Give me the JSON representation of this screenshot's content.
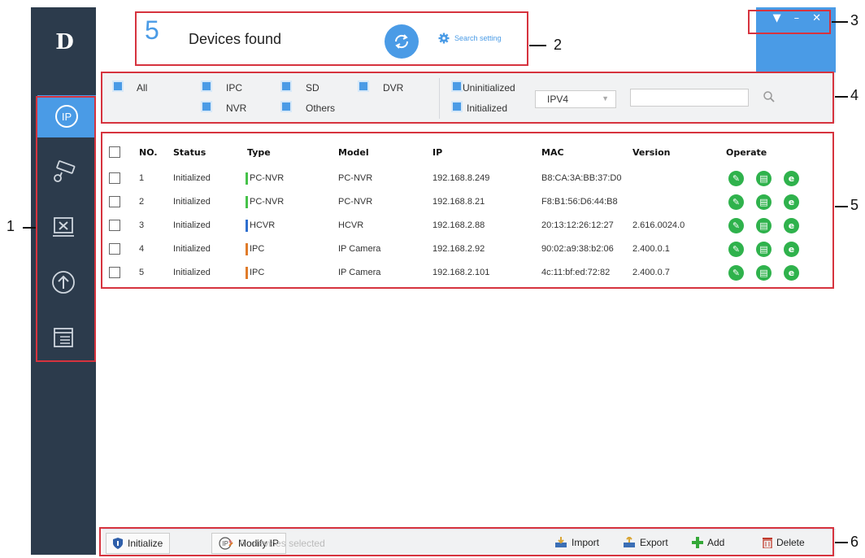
{
  "sidebar": {
    "logo": "D",
    "items": [
      {
        "name": "ip-search-icon",
        "active": true
      },
      {
        "name": "camera-config-icon",
        "active": false
      },
      {
        "name": "tools-icon",
        "active": false
      },
      {
        "name": "upgrade-icon",
        "active": false
      },
      {
        "name": "list-icon",
        "active": false
      }
    ]
  },
  "header": {
    "device_count": "5",
    "found_label": "Devices found",
    "search_setting_label": "Search setting",
    "window_controls": [
      "▼",
      "–",
      "✕"
    ]
  },
  "filters": {
    "all": "All",
    "ipc": "IPC",
    "sd": "SD",
    "dvr": "DVR",
    "nvr": "NVR",
    "others": "Others",
    "uninitialized": "Uninitialized",
    "initialized": "Initialized",
    "ip_version": "IPV4",
    "search_placeholder": ""
  },
  "table": {
    "columns": [
      "NO.",
      "Status",
      "Type",
      "Model",
      "IP",
      "MAC",
      "Version",
      "Operate"
    ],
    "rows": [
      {
        "no": "1",
        "status": "Initialized",
        "type": "PC-NVR",
        "type_color": "#46c24a",
        "model": "PC-NVR",
        "ip": "192.168.8.249",
        "mac": "B8:CA:3A:BB:37:D0",
        "version": ""
      },
      {
        "no": "2",
        "status": "Initialized",
        "type": "PC-NVR",
        "type_color": "#46c24a",
        "model": "PC-NVR",
        "ip": "192.168.8.21",
        "mac": "F8:B1:56:D6:44:B8",
        "version": ""
      },
      {
        "no": "3",
        "status": "Initialized",
        "type": "HCVR",
        "type_color": "#2f6fcf",
        "model": "HCVR",
        "ip": "192.168.2.88",
        "mac": "20:13:12:26:12:27",
        "version": "2.616.0024.0"
      },
      {
        "no": "4",
        "status": "Initialized",
        "type": "IPC",
        "type_color": "#e07b2a",
        "model": "IP Camera",
        "ip": "192.168.2.92",
        "mac": "90:02:a9:38:b2:06",
        "version": "2.400.0.1"
      },
      {
        "no": "5",
        "status": "Initialized",
        "type": "IPC",
        "type_color": "#e07b2a",
        "model": "IP Camera",
        "ip": "192.168.2.101",
        "mac": "4c:11:bf:ed:72:82",
        "version": "2.400.0.7"
      }
    ]
  },
  "bottom": {
    "initialize": "Initialize",
    "modify_ip": "Modify IP",
    "star": "*",
    "selected_count": "0",
    "selected_label": "devices selected",
    "import": "Import",
    "export": "Export",
    "add": "Add",
    "delete": "Delete"
  },
  "annotations": [
    "1",
    "2",
    "3",
    "4",
    "5",
    "6"
  ],
  "colors": {
    "accent": "#4a9be6",
    "sidebar": "#2c3b4c",
    "operate": "#2fb24c",
    "annotation": "#d6333e"
  }
}
